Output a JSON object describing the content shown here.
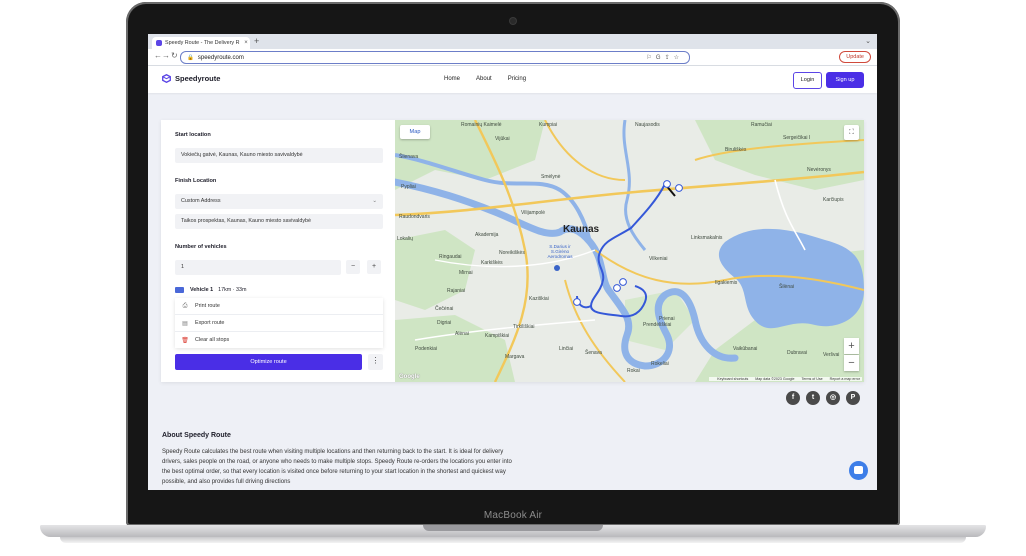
{
  "device": {
    "label": "MacBook Air"
  },
  "browser": {
    "tab_title": "Speedy Route - The Delivery R",
    "url": "speedyroute.com",
    "update_label": "Update"
  },
  "header": {
    "brand": "Speedyroute",
    "nav": [
      "Home",
      "About",
      "Pricing"
    ],
    "login": "Login",
    "signup": "Sign up"
  },
  "planner": {
    "start_label": "Start location",
    "start_value": "Vokiečių gatvė, Kaunas, Kauno miesto savivaldybė",
    "finish_label": "Finish Location",
    "finish_mode": "Custom Address",
    "finish_value": "Taikos prospektas, Kaunas, Kauno miesto savivaldybė",
    "vehicles_label": "Number of vehicles",
    "vehicles_value": "1",
    "minus": "−",
    "plus": "+",
    "vehicle_name": "Vehicle 1",
    "vehicle_stats": "17km · 33m",
    "menu": [
      "Print route",
      "Export route",
      "Clear all stops"
    ],
    "optimize": "Optimize route",
    "more": "⋮"
  },
  "map": {
    "type_button": "Map",
    "city": "Kaunas",
    "airport": "S.Darius ir S.Girėno Aerodromas",
    "labels": [
      "Romainių Kaimelė",
      "Kumpiai",
      "Naujasodis",
      "Ramučiai",
      "Vijūkai",
      "Šlienava",
      "Sergeičikai I",
      "Biruliškės",
      "Smėlynė",
      "Nevėronys",
      "Pypliai",
      "Karčiupis",
      "Akademija",
      "Lokalių",
      "Ringaudai",
      "Noreikiškės",
      "Karkiškės",
      "Mirnai",
      "Ilgakiemis",
      "Vilijampolė",
      "Rajaniai",
      "Kaziškiai",
      "Čečėnai",
      "Digriai",
      "Tirkiliškiai",
      "Kampiškiai",
      "Prienai",
      "Alėnai",
      "Podenkiai",
      "Linčiai",
      "Šenava",
      "Rokai",
      "Rokeliai",
      "Raudondvaris",
      "Margava",
      "Vaikūbanai",
      "Dubravai",
      "Šilėnai",
      "Veršvai",
      "Linksmakalnis",
      "Prendėliškiai",
      "Vilkeniai"
    ],
    "google": "Google",
    "attribution": [
      "Keyboard shortcuts",
      "Map data ©2023 Google",
      "Terms of Use",
      "Report a map error"
    ],
    "zoom_in": "+",
    "zoom_out": "−",
    "fullscreen": "⛶"
  },
  "social": [
    "f",
    "t",
    "◎",
    "P"
  ],
  "about": {
    "title": "About Speedy Route",
    "text": "Speedy Route calculates the best route when visiting multiple locations and then returning back to the start. It is ideal for delivery drivers, sales people on the road, or anyone who needs to make multiple stops. Speedy Route re-orders the locations you enter into the best optimal order, so that every location is visited once before returning to your start location in the shortest and quickest way possible, and also provides full driving directions"
  },
  "colors": {
    "accent": "#4a2ee6",
    "route": "#3558d8",
    "map_green": "#cfe5c4",
    "water": "#8fb3e8"
  }
}
